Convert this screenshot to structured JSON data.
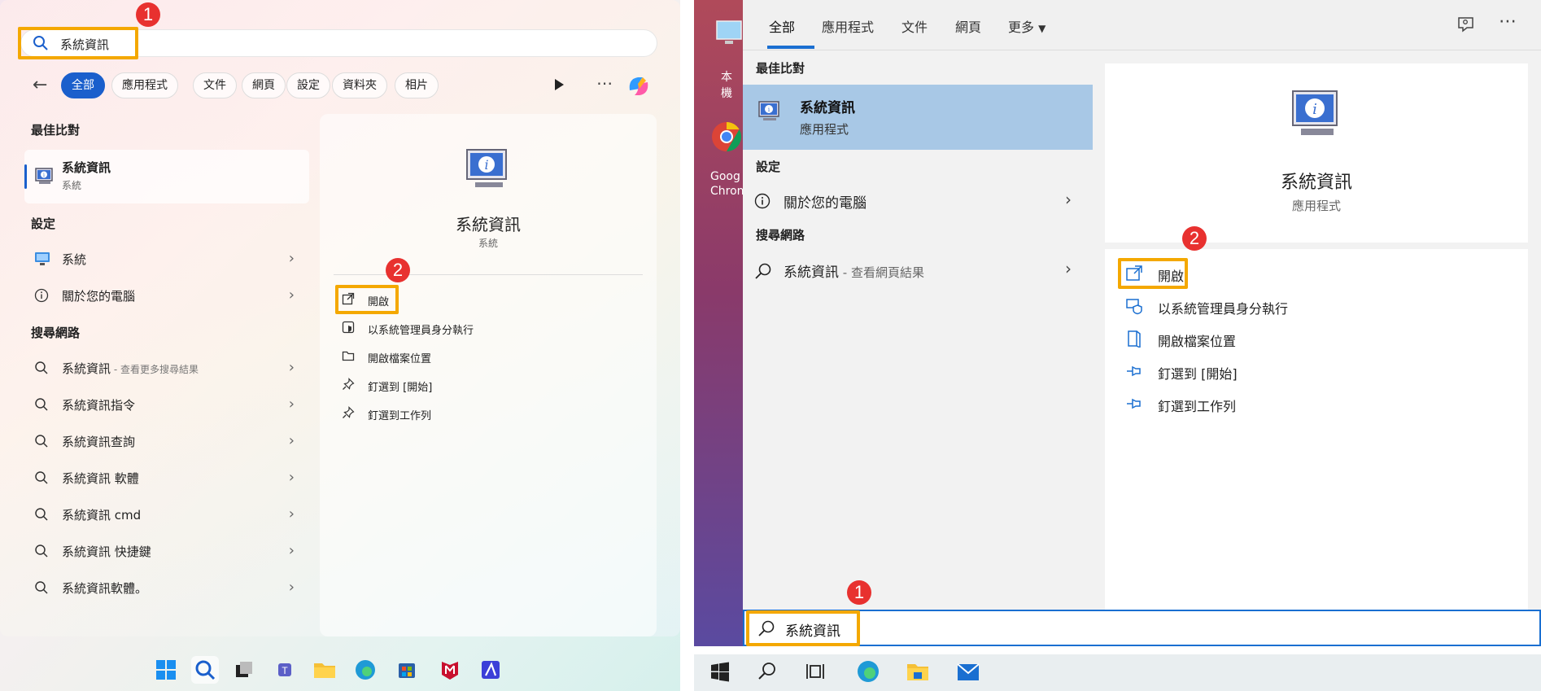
{
  "win11": {
    "search": {
      "value": "系統資訊"
    },
    "back_label": "←",
    "chips": [
      "全部",
      "應用程式",
      "文件",
      "網頁",
      "設定",
      "資料夾",
      "相片"
    ],
    "best_match": {
      "heading": "最佳比對",
      "title": "系統資訊",
      "subtitle": "系統"
    },
    "settings": {
      "heading": "設定",
      "items": [
        "系統",
        "關於您的電腦"
      ]
    },
    "web": {
      "heading": "搜尋網路",
      "items": [
        {
          "label": "系統資訊",
          "sub": " - 查看更多搜尋結果"
        },
        {
          "label": "系統資訊指令",
          "sub": ""
        },
        {
          "label": "系統資訊查詢",
          "sub": ""
        },
        {
          "label": "系統資訊 軟體",
          "sub": ""
        },
        {
          "label": "系統資訊 cmd",
          "sub": ""
        },
        {
          "label": "系統資訊 快捷鍵",
          "sub": ""
        },
        {
          "label": "系統資訊軟體。",
          "sub": ""
        }
      ]
    },
    "detail": {
      "title": "系統資訊",
      "subtitle": "系統",
      "actions": [
        "開啟",
        "以系統管理員身分執行",
        "開啟檔案位置",
        "釘選到 [開始]",
        "釘選到工作列"
      ]
    },
    "badges": [
      "1",
      "2"
    ]
  },
  "win10": {
    "tabs": [
      "全部",
      "應用程式",
      "文件",
      "網頁",
      "更多"
    ],
    "desktop_icons": [
      "本機",
      "Goog",
      "Chron"
    ],
    "best_match": {
      "heading": "最佳比對",
      "title": "系統資訊",
      "subtitle": "應用程式"
    },
    "settings": {
      "heading": "設定",
      "items": [
        "關於您的電腦"
      ]
    },
    "web": {
      "heading": "搜尋網路",
      "items": [
        {
          "label": "系統資訊",
          "sub": " - 查看網頁結果"
        }
      ]
    },
    "detail": {
      "title": "系統資訊",
      "subtitle": "應用程式",
      "actions": [
        "開啟",
        "以系統管理員身分執行",
        "開啟檔案位置",
        "釘選到 [開始]",
        "釘選到工作列"
      ]
    },
    "search": {
      "value": "系統資訊"
    },
    "badges": [
      "1",
      "2"
    ]
  },
  "colors": {
    "highlight": "#f4a800",
    "badge": "#e8312f",
    "accent10": "#1a6fd1",
    "accent11": "#1a5fcc"
  }
}
